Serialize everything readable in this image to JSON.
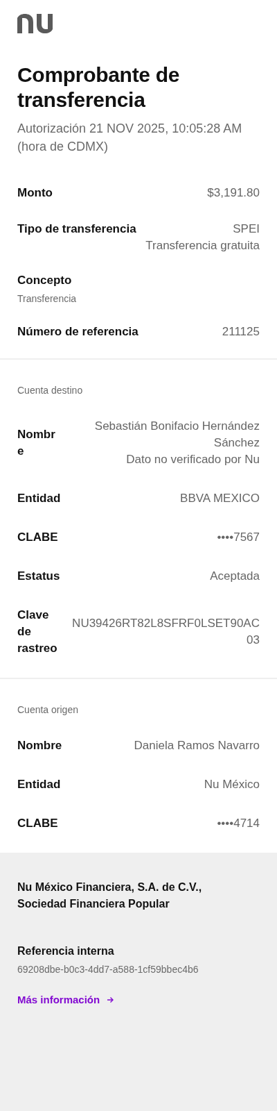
{
  "title": "Comprobante de transferencia",
  "subtitle": "Autorización 21 NOV 2025, 10:05:28 AM (hora de CDMX)",
  "summary": [
    {
      "kind": "inline",
      "label": "Monto",
      "values": [
        "$3,191.80"
      ]
    },
    {
      "kind": "inline",
      "label": "Tipo de transferencia",
      "values": [
        "SPEI",
        "Transferencia gratuita"
      ]
    },
    {
      "kind": "stacked",
      "label": "Concepto",
      "values": [
        "Transferencia"
      ]
    },
    {
      "kind": "inline",
      "label": "Número de referencia",
      "values": [
        "211125"
      ]
    }
  ],
  "sections": [
    {
      "heading": "Cuenta destino",
      "rows": [
        {
          "label": "Nombre",
          "values": [
            "Sebastián Bonifacio Hernández Sánchez",
            "Dato no verificado por Nu"
          ]
        },
        {
          "label": "Entidad",
          "values": [
            "BBVA MEXICO"
          ]
        },
        {
          "label": "CLABE",
          "values": [
            "••••7567"
          ]
        },
        {
          "label": "Estatus",
          "values": [
            "Aceptada"
          ]
        },
        {
          "label": "Clave de rastreo",
          "values": [
            "NU39426RT82L8SFRF0LSET90AC03"
          ]
        }
      ]
    },
    {
      "heading": "Cuenta origen",
      "rows": [
        {
          "label": "Nombre",
          "values": [
            "Daniela Ramos Navarro"
          ]
        },
        {
          "label": "Entidad",
          "values": [
            "Nu México"
          ]
        },
        {
          "label": "CLABE",
          "values": [
            "••••4714"
          ]
        }
      ]
    }
  ],
  "footer": {
    "company": "Nu México Financiera, S.A. de C.V., Sociedad Financiera Popular",
    "reference_label": "Referencia interna",
    "reference_value": "69208dbe-b0c3-4dd7-a588-1cf59bbec4b6",
    "link": "Más información"
  }
}
